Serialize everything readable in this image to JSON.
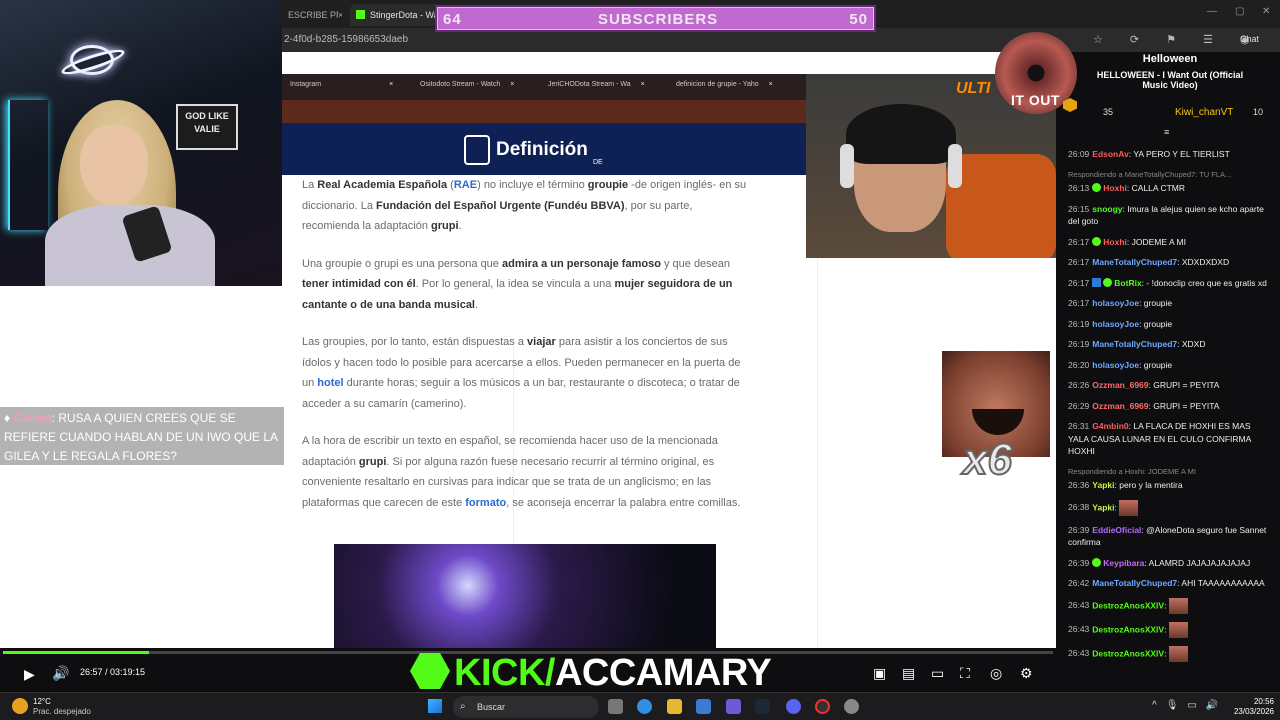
{
  "browser": {
    "tabs": [
      {
        "label": "ESCRIBE PR",
        "close": "×"
      },
      {
        "label": "StingerDota - Watc",
        "close": "×"
      }
    ],
    "address": "2-4f0d-b285-15986653daeb",
    "chat_button": "Chat",
    "window_controls": [
      "—",
      "▢",
      "✕"
    ]
  },
  "sub_goal": {
    "current": "64",
    "label": "SUBSCRIBERS",
    "target": "50"
  },
  "webcam": {
    "sign_text": "GOD LIKE VALIE"
  },
  "tts_message": {
    "user": "Galleta",
    "separator": ":",
    "text": "RUSA A QUIEN CREES QUE SE REFIERE CUANDO HABLAN DE UN IWO QUE LA GILEA Y LE REGALA FLORES?"
  },
  "inner_tabs": [
    {
      "label": "Instagram"
    },
    {
      "label": "Ositodoto Stream - Watch"
    },
    {
      "label": "JeriCHODota Stream - Wa"
    },
    {
      "label": "definicion de grupie - Yaho"
    }
  ],
  "site": {
    "logo": "Definición",
    "logo_suffix": "DE"
  },
  "article": {
    "p1": {
      "a": "La ",
      "b": "Real Academia Española",
      "c": " (",
      "d": "RAE",
      "e": ") no incluye el término ",
      "f": "groupie",
      "g": " -de origen inglés- en su diccionario. La ",
      "h": "Fundación del Español Urgente (Fundéu BBVA)",
      "i": ", por su parte, recomienda la adaptación ",
      "j": "grupi",
      "k": "."
    },
    "p2": {
      "a": "Una groupie o grupi es una persona que ",
      "b": "admira a un personaje famoso",
      "c": " y que desean ",
      "d": "tener intimidad con él",
      "e": ". Por lo general, la idea se vincula a una ",
      "f": "mujer seguidora de un cantante o de una banda musical",
      "g": "."
    },
    "p3": {
      "a": "Las groupies, por lo tanto, están dispuestas a ",
      "b": "viajar",
      "c": " para asistir a los conciertos de sus ídolos y hacen todo lo posible para acercarse a ellos. Pueden permanecer en la puerta de un ",
      "d": "hotel",
      "e": " durante horas; seguir a los músicos a un bar, restaurante o discoteca; o tratar de acceder a su camarín (camerino)."
    },
    "p4": {
      "a": "A la hora de escribir un texto en español, se recomienda hacer uso de la mencionada adaptación ",
      "b": "grupi",
      "c": ". Si por alguna razón fuese necesario recurrir al término original, es conveniente resaltarlo en cursivas para indicar que se trata de un anglicismo; en las plataformas que carecen de este ",
      "d": "formato",
      "e": ", se aconseja encerrar la palabra entre comillas."
    }
  },
  "cam2": {
    "overlay_text": "ULTI"
  },
  "music": {
    "out": "IT OUT",
    "title": "Helloween",
    "subtitle": "HELLOWEEN - I Want Out (Official Music Video)"
  },
  "chat_top": {
    "n1": "35",
    "user2": "Kiwi_chanVT",
    "n2": "10",
    "collapse": "≡"
  },
  "chat": [
    {
      "time": "26:09",
      "user": "EdsonAv",
      "color": "#ff5b5b",
      "text": "YA PERO Y EL TIERLIST"
    },
    {
      "reply": "Respondiendo a ManeTotallyChuped7: TU FLA..."
    },
    {
      "time": "26:13",
      "badge": "ok",
      "user": "Hoxhi",
      "color": "#ff5b5b",
      "text": "CALLA CTMR"
    },
    {
      "time": "26:15",
      "user": "snoogy",
      "color": "#53fc18",
      "text": "Imura la alejus quien se kcho aparte del goto"
    },
    {
      "time": "26:17",
      "badge": "ok",
      "user": "Hoxhi",
      "color": "#ff5b5b",
      "text": "JODEME A MI"
    },
    {
      "time": "26:17",
      "user": "ManeTotallyChuped7",
      "color": "#6ea8ff",
      "text": "XDXDXDXD"
    },
    {
      "time": "26:17",
      "badge": "both",
      "user": "BotRix",
      "color": "#53fc18",
      "text": "- !donoclip creo que es gratis xd"
    },
    {
      "time": "26:17",
      "user": "holasoyJoe",
      "color": "#6ea8ff",
      "text": "groupie"
    },
    {
      "time": "26:19",
      "user": "holasoyJoe",
      "color": "#6ea8ff",
      "text": "groupie"
    },
    {
      "time": "26:19",
      "user": "ManeTotallyChuped7",
      "color": "#6ea8ff",
      "text": "XDXD"
    },
    {
      "time": "26:20",
      "user": "holasoyJoe",
      "color": "#6ea8ff",
      "text": "groupie"
    },
    {
      "time": "26:26",
      "user": "Ozzman_6969",
      "color": "#ff6b6b",
      "text": "GRUPI = PEYITA"
    },
    {
      "time": "26:29",
      "user": "Ozzman_6969",
      "color": "#ff6b6b",
      "text": "GRUPI = PEYITA"
    },
    {
      "time": "26:31",
      "user": "G4mbin0",
      "color": "#ff5b5b",
      "text": "LA FLACA DE HOXHI ES MAS YALA CAUSA LUNAR EN EL CULO CONFIRMA HOXHI"
    },
    {
      "reply": "Respondiendo a Hoxhi: JODEME A MI"
    },
    {
      "time": "26:36",
      "user": "Yapki",
      "color": "#c5f24a",
      "text": "pero y la mentira"
    },
    {
      "time": "26:38",
      "user": "Yapki",
      "color": "#c5f24a",
      "emote": true
    },
    {
      "time": "26:39",
      "user": "EddieOficial",
      "color": "#b36bff",
      "text": "@AloneDota seguro fue Sannet confirma"
    },
    {
      "time": "26:39",
      "badge": "ok",
      "user": "Keypibara",
      "color": "#c56bff",
      "text": "ALAMRD JAJAJAJAJAJAJ"
    },
    {
      "time": "26:42",
      "user": "ManeTotallyChuped7",
      "color": "#6ea8ff",
      "text": "AHI TAAAAAAAAAAA"
    },
    {
      "time": "26:43",
      "user": "DestrozAnosXXIV",
      "color": "#53fc18",
      "emote": true
    },
    {
      "time": "26:43",
      "user": "DestrozAnosXXIV",
      "color": "#53fc18",
      "emote": true
    },
    {
      "time": "26:43",
      "user": "DestrozAnosXXIV",
      "color": "#53fc18",
      "emote": true
    }
  ],
  "emote_multiplier": "x6",
  "player": {
    "progress": 0.139,
    "time": "26:57 / 03:19:15",
    "play_icon": "▶",
    "volume_icon": "🔊",
    "right_icons": [
      "▣",
      "▤",
      "▭",
      "⛶",
      "◎",
      "⚙"
    ]
  },
  "brand": {
    "kick": "KICK",
    "slash": "/",
    "channel": "ACCAMARY"
  },
  "taskbar": {
    "temp": "12°C",
    "weather": "Prac. despejado",
    "search": "Buscar",
    "time": "20:56",
    "date": "23/03/2026",
    "tray": [
      "^",
      "🎙",
      "▭",
      "🔊"
    ]
  },
  "colors": {
    "kick_green": "#53fc18",
    "sub_bar": "#c06ad0",
    "chat_bg": "#0e0e10"
  }
}
